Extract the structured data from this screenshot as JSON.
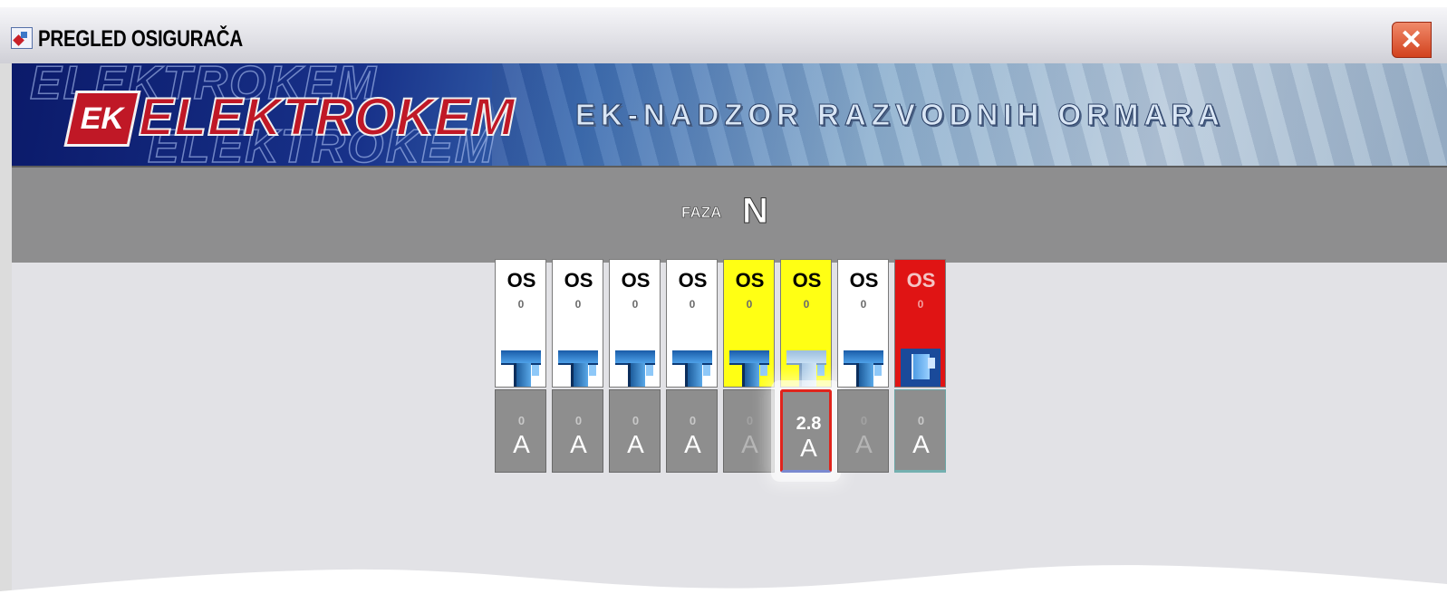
{
  "window": {
    "title": "PREGLED OSIGURAČA",
    "close_label": "✕"
  },
  "banner": {
    "logo_mark": "EK",
    "logo_text": "ELEKTROKEM",
    "title": "EK-NADZOR RAZVODNIH ORMARA"
  },
  "phase": {
    "label": "FAZA",
    "value": "N"
  },
  "fuses": [
    {
      "label": "OS",
      "indicator": "0",
      "value": "0",
      "unit": "A",
      "state": "white"
    },
    {
      "label": "OS",
      "indicator": "0",
      "value": "0",
      "unit": "A",
      "state": "white"
    },
    {
      "label": "OS",
      "indicator": "0",
      "value": "0",
      "unit": "A",
      "state": "white"
    },
    {
      "label": "OS",
      "indicator": "0",
      "value": "0",
      "unit": "A",
      "state": "white"
    },
    {
      "label": "OS",
      "indicator": "0",
      "value": "0",
      "unit": "A",
      "state": "yellow"
    },
    {
      "label": "OS",
      "indicator": "0",
      "value": "2.8",
      "unit": "A",
      "state": "yellow",
      "selected": true
    },
    {
      "label": "OS",
      "indicator": "0",
      "value": "0",
      "unit": "A",
      "state": "white"
    },
    {
      "label": "OS",
      "indicator": "0",
      "value": "0",
      "unit": "A",
      "state": "red"
    }
  ],
  "colors": {
    "normal": "#ffffff",
    "warning": "#ffff14",
    "fault": "#e01414",
    "selection": "#e0241c"
  }
}
